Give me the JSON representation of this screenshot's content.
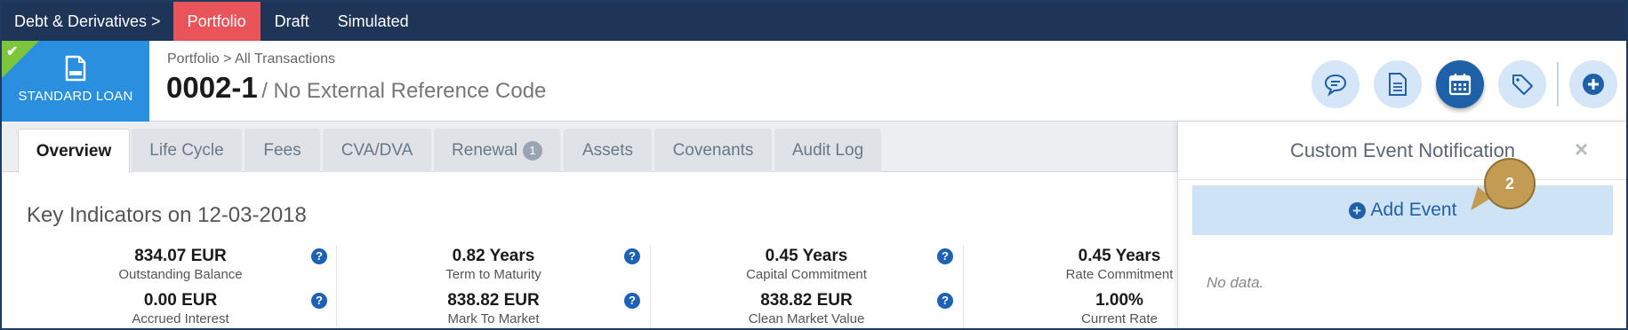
{
  "topnav": {
    "breadcrumb": "Debt & Derivatives >",
    "tabs": [
      {
        "label": "Portfolio",
        "active": true
      },
      {
        "label": "Draft",
        "active": false
      },
      {
        "label": "Simulated",
        "active": false
      }
    ]
  },
  "header": {
    "loan_type": "STANDARD LOAN",
    "breadcrumb": "Portfolio > All Transactions",
    "code": "0002-1",
    "reference": "/ No External Reference Code",
    "buttons": [
      {
        "name": "comment-button",
        "icon": "comment-icon"
      },
      {
        "name": "document-button",
        "icon": "document-icon"
      },
      {
        "name": "calendar-button",
        "icon": "calendar-icon",
        "active": true
      },
      {
        "name": "tag-button",
        "icon": "tag-icon"
      },
      {
        "name": "add-button",
        "icon": "plus-circle-icon"
      }
    ]
  },
  "tabs": [
    {
      "label": "Overview",
      "active": true
    },
    {
      "label": "Life Cycle"
    },
    {
      "label": "Fees"
    },
    {
      "label": "CVA/DVA"
    },
    {
      "label": "Renewal",
      "count": "1"
    },
    {
      "label": "Assets"
    },
    {
      "label": "Covenants"
    },
    {
      "label": "Audit Log"
    }
  ],
  "key_indicators": {
    "title": "Key Indicators on 12-03-2018",
    "items": [
      {
        "value": "834.07 EUR",
        "label": "Outstanding Balance"
      },
      {
        "value": "0.82 Years",
        "label": "Term to Maturity"
      },
      {
        "value": "0.45 Years",
        "label": "Capital Commitment"
      },
      {
        "value": "0.45 Years",
        "label": "Rate Commitment"
      },
      {
        "value": "0.00 EUR",
        "label": "Accrued Interest"
      },
      {
        "value": "838.82 EUR",
        "label": "Mark To Market"
      },
      {
        "value": "838.82 EUR",
        "label": "Clean Market Value"
      },
      {
        "value": "1.00%",
        "label": "Current Rate"
      }
    ]
  },
  "panel": {
    "title": "Custom Event Notification",
    "close": "×",
    "add_event": "Add Event",
    "no_data": "No data."
  },
  "callout": "2",
  "colors": {
    "nav": "#1e3557",
    "active_tab": "#e8545a",
    "badge": "#2b8fe0",
    "accent": "#1f61a8"
  }
}
